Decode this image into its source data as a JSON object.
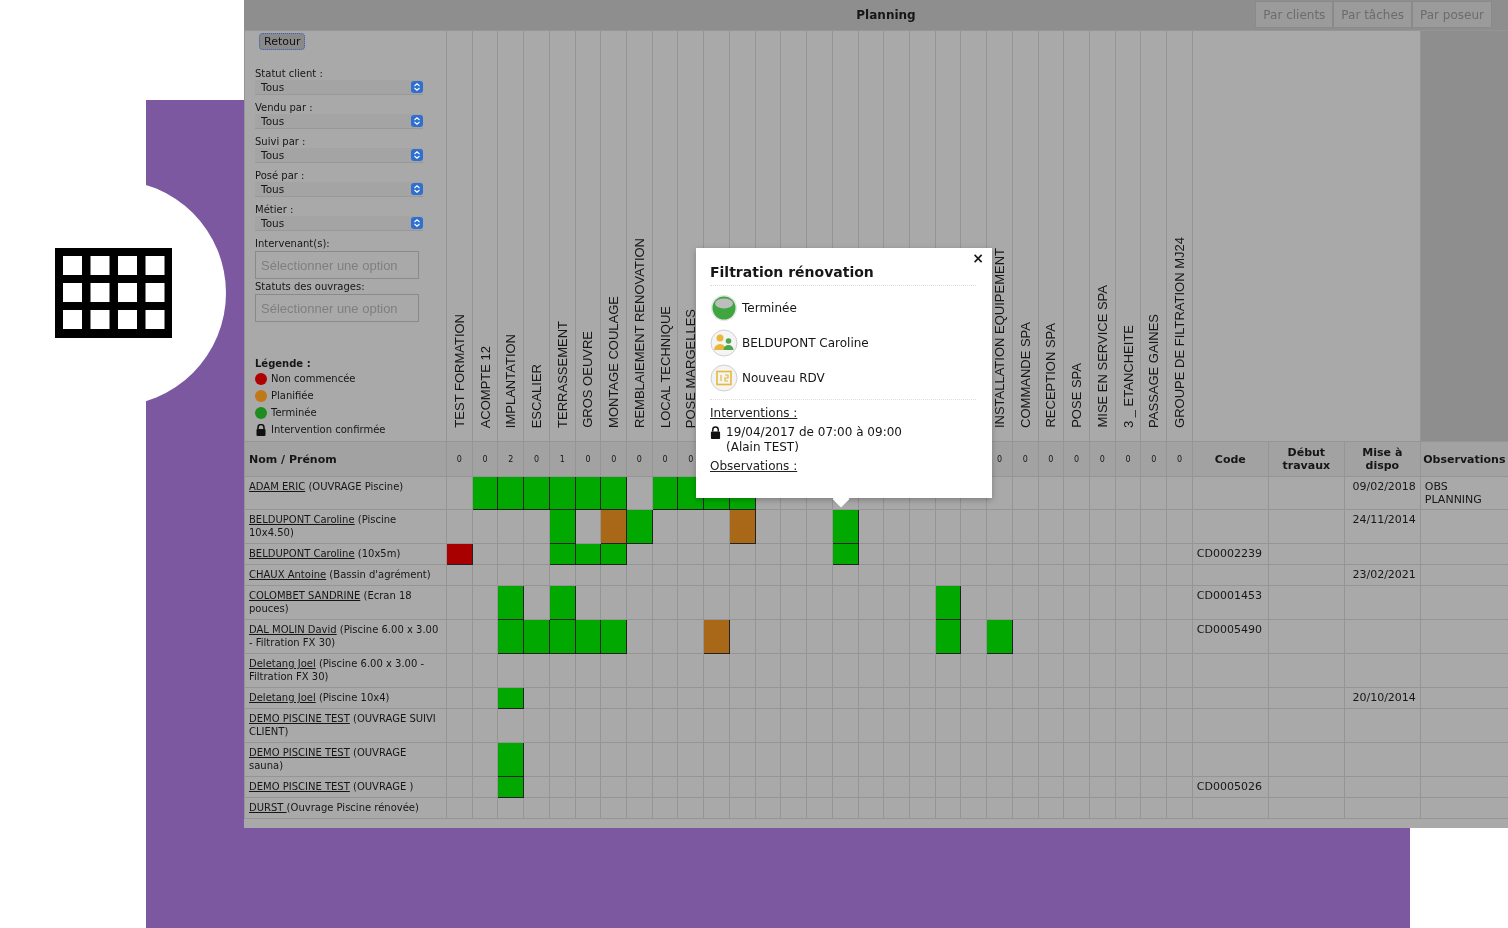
{
  "window": {
    "title": "Planning"
  },
  "view_buttons": [
    {
      "label": "Par clients"
    },
    {
      "label": "Par tâches"
    },
    {
      "label": "Par poseur"
    }
  ],
  "back_button": "Retour",
  "filters": [
    {
      "kind": "select",
      "label": "Statut client :",
      "value": "Tous"
    },
    {
      "kind": "select",
      "label": "Vendu par :",
      "value": "Tous"
    },
    {
      "kind": "select",
      "label": "Suivi par :",
      "value": "Tous"
    },
    {
      "kind": "select",
      "label": "Posé par :",
      "value": "Tous"
    },
    {
      "kind": "select",
      "label": "Métier :",
      "value": "Tous"
    },
    {
      "kind": "multiselect",
      "label": "Intervenant(s):",
      "placeholder": "Sélectionner une option"
    },
    {
      "kind": "multiselect",
      "label": "Statuts des ouvrages:",
      "placeholder": "Sélectionner une option"
    }
  ],
  "legend": {
    "title": "Légende :",
    "items": [
      {
        "kind": "dot",
        "color": "#b00000",
        "label": "Non commencée"
      },
      {
        "kind": "dot",
        "color": "#c07818",
        "label": "Planifiée"
      },
      {
        "kind": "dot",
        "color": "#1e8c1e",
        "label": "Terminée"
      },
      {
        "kind": "lock",
        "label": "Intervention confirmée"
      }
    ]
  },
  "table": {
    "name_header": "Nom / Prénom",
    "task_columns": [
      {
        "label": "TEST FORMATION",
        "count": "0"
      },
      {
        "label": "ACOMPTE  12",
        "count": "0"
      },
      {
        "label": "IMPLANTATION",
        "count": "2"
      },
      {
        "label": "ESCALIER",
        "count": "0"
      },
      {
        "label": "TERRASSEMENT",
        "count": "1"
      },
      {
        "label": "GROS OEUVRE",
        "count": "0"
      },
      {
        "label": "MONTAGE COULAGE",
        "count": "0"
      },
      {
        "label": "REMBLAIEMENT  RENOVATION",
        "count": "0"
      },
      {
        "label": "LOCAL TECHNIQUE",
        "count": "0"
      },
      {
        "label": "POSE MARGELLES",
        "count": "0"
      },
      {},
      {},
      {},
      {},
      {},
      {},
      {},
      {},
      {},
      {},
      {},
      {
        "label": "INSTALLATION EQUIPEMENT",
        "count": "0"
      },
      {
        "label": "COMMANDE SPA",
        "count": "0"
      },
      {
        "label": "RECEPTION SPA",
        "count": "0"
      },
      {
        "label": "POSE SPA",
        "count": "0"
      },
      {
        "label": "MISE EN SERVICE SPA",
        "count": "0"
      },
      {
        "label": "3 _ ETANCHEITE",
        "count": "0"
      },
      {
        "label": "PASSAGE GAINES",
        "count": "0"
      },
      {
        "label": "GROUPE DE FILTRATION MJ24",
        "count": "0"
      }
    ],
    "info_columns": [
      "Code",
      "Début travaux",
      "Mise à dispo",
      "Observations"
    ],
    "rows": [
      {
        "name": "ADAM ERIC",
        "description": "(OUVRAGE Piscine)",
        "available": "09/02/2018",
        "observations": "OBS PLANNING",
        "cells": [
          {
            "kind": "empty"
          },
          {
            "kind": "done"
          },
          {
            "kind": "done"
          },
          {
            "kind": "done"
          },
          {
            "kind": "done"
          },
          {
            "kind": "done"
          },
          {
            "kind": "done"
          },
          {
            "kind": "empty"
          },
          {
            "kind": "done"
          },
          {
            "kind": "done"
          },
          {
            "kind": "done"
          },
          {
            "kind": "done"
          },
          {
            "kind": "empty"
          },
          {
            "kind": "empty"
          },
          {
            "kind": "empty"
          },
          {
            "kind": "empty"
          },
          {
            "kind": "empty"
          },
          {
            "kind": "empty"
          },
          {
            "kind": "empty"
          },
          {
            "kind": "empty"
          },
          {
            "kind": "empty"
          },
          {
            "kind": "empty"
          },
          {
            "kind": "empty"
          },
          {
            "kind": "empty"
          },
          {
            "kind": "empty"
          },
          {
            "kind": "empty"
          },
          {
            "kind": "empty"
          },
          {
            "kind": "empty"
          },
          {
            "kind": "empty"
          }
        ]
      },
      {
        "name": "BELDUPONT Caroline",
        "description": "(Piscine 10x4.50)",
        "available": "24/11/2014",
        "cells": [
          {
            "kind": "empty"
          },
          {
            "kind": "empty"
          },
          {
            "kind": "empty"
          },
          {
            "kind": "empty"
          },
          {
            "kind": "done"
          },
          {
            "kind": "empty"
          },
          {
            "kind": "planned"
          },
          {
            "kind": "done"
          },
          {
            "kind": "empty"
          },
          {
            "kind": "empty"
          },
          {
            "kind": "empty"
          },
          {
            "kind": "planned"
          },
          {
            "kind": "empty"
          },
          {
            "kind": "empty"
          },
          {
            "kind": "empty"
          },
          {
            "kind": "done"
          },
          {
            "kind": "empty"
          },
          {
            "kind": "empty"
          },
          {
            "kind": "empty"
          },
          {
            "kind": "empty"
          },
          {
            "kind": "empty"
          },
          {
            "kind": "empty"
          },
          {
            "kind": "empty"
          },
          {
            "kind": "empty"
          },
          {
            "kind": "empty"
          },
          {
            "kind": "empty"
          },
          {
            "kind": "empty"
          },
          {
            "kind": "empty"
          },
          {
            "kind": "empty"
          }
        ]
      },
      {
        "name": "BELDUPONT Caroline",
        "description": "(10x5m)",
        "code": "CD0002239",
        "cells": [
          {
            "kind": "not_started"
          },
          {
            "kind": "empty"
          },
          {
            "kind": "empty"
          },
          {
            "kind": "empty"
          },
          {
            "kind": "done"
          },
          {
            "kind": "done"
          },
          {
            "kind": "done"
          },
          {
            "kind": "empty"
          },
          {
            "kind": "empty"
          },
          {
            "kind": "empty"
          },
          {
            "kind": "empty"
          },
          {
            "kind": "empty"
          },
          {
            "kind": "empty"
          },
          {
            "kind": "empty"
          },
          {
            "kind": "empty"
          },
          {
            "kind": "done"
          },
          {
            "kind": "empty"
          },
          {
            "kind": "empty"
          },
          {
            "kind": "empty"
          },
          {
            "kind": "empty"
          },
          {
            "kind": "empty"
          },
          {
            "kind": "empty"
          },
          {
            "kind": "empty"
          },
          {
            "kind": "empty"
          },
          {
            "kind": "empty"
          },
          {
            "kind": "empty"
          },
          {
            "kind": "empty"
          },
          {
            "kind": "empty"
          },
          {
            "kind": "empty"
          }
        ]
      },
      {
        "name": "CHAUX Antoine",
        "description": "(Bassin d'agrément)",
        "available": "23/02/2021",
        "cells": [
          {
            "kind": "empty"
          },
          {
            "kind": "empty"
          },
          {
            "kind": "empty"
          },
          {
            "kind": "empty"
          },
          {
            "kind": "empty"
          },
          {
            "kind": "empty"
          },
          {
            "kind": "empty"
          },
          {
            "kind": "empty"
          },
          {
            "kind": "empty"
          },
          {
            "kind": "empty"
          },
          {
            "kind": "empty"
          },
          {
            "kind": "empty"
          },
          {
            "kind": "empty"
          },
          {
            "kind": "empty"
          },
          {
            "kind": "empty"
          },
          {
            "kind": "empty"
          },
          {
            "kind": "empty"
          },
          {
            "kind": "empty"
          },
          {
            "kind": "empty"
          },
          {
            "kind": "empty"
          },
          {
            "kind": "empty"
          },
          {
            "kind": "empty"
          },
          {
            "kind": "empty"
          },
          {
            "kind": "empty"
          },
          {
            "kind": "empty"
          },
          {
            "kind": "empty"
          },
          {
            "kind": "empty"
          },
          {
            "kind": "empty"
          },
          {
            "kind": "empty"
          }
        ]
      },
      {
        "name": "COLOMBET SANDRINE",
        "description": "(Ecran 18 pouces)",
        "code": "CD0001453",
        "cells": [
          {
            "kind": "empty"
          },
          {
            "kind": "empty"
          },
          {
            "kind": "done"
          },
          {
            "kind": "empty"
          },
          {
            "kind": "done"
          },
          {
            "kind": "empty"
          },
          {
            "kind": "empty"
          },
          {
            "kind": "empty"
          },
          {
            "kind": "empty"
          },
          {
            "kind": "empty"
          },
          {
            "kind": "empty"
          },
          {
            "kind": "empty"
          },
          {
            "kind": "empty"
          },
          {
            "kind": "empty"
          },
          {
            "kind": "empty"
          },
          {
            "kind": "empty"
          },
          {
            "kind": "empty"
          },
          {
            "kind": "empty"
          },
          {
            "kind": "empty"
          },
          {
            "kind": "done"
          },
          {
            "kind": "empty"
          },
          {
            "kind": "empty"
          },
          {
            "kind": "empty"
          },
          {
            "kind": "empty"
          },
          {
            "kind": "empty"
          },
          {
            "kind": "empty"
          },
          {
            "kind": "empty"
          },
          {
            "kind": "empty"
          },
          {
            "kind": "empty"
          }
        ]
      },
      {
        "name": "DAL MOLIN David",
        "description": "(Piscine 6.00 x 3.00 - Filtration FX 30)",
        "code": "CD0005490",
        "cells": [
          {
            "kind": "empty"
          },
          {
            "kind": "empty"
          },
          {
            "kind": "done"
          },
          {
            "kind": "done"
          },
          {
            "kind": "done"
          },
          {
            "kind": "done"
          },
          {
            "kind": "done"
          },
          {
            "kind": "empty"
          },
          {
            "kind": "empty"
          },
          {
            "kind": "empty"
          },
          {
            "kind": "planned"
          },
          {
            "kind": "empty"
          },
          {
            "kind": "empty"
          },
          {
            "kind": "empty"
          },
          {
            "kind": "empty"
          },
          {
            "kind": "empty"
          },
          {
            "kind": "empty"
          },
          {
            "kind": "empty"
          },
          {
            "kind": "empty"
          },
          {
            "kind": "done"
          },
          {
            "kind": "empty"
          },
          {
            "kind": "done"
          },
          {
            "kind": "empty"
          },
          {
            "kind": "empty"
          },
          {
            "kind": "empty"
          },
          {
            "kind": "empty"
          },
          {
            "kind": "empty"
          },
          {
            "kind": "empty"
          },
          {
            "kind": "empty"
          }
        ]
      },
      {
        "name": "Deletang Joel",
        "description": "(Piscine 6.00 x 3.00 - Filtration FX 30)",
        "cells": [
          {
            "kind": "empty"
          },
          {
            "kind": "empty"
          },
          {
            "kind": "empty"
          },
          {
            "kind": "empty"
          },
          {
            "kind": "empty"
          },
          {
            "kind": "empty"
          },
          {
            "kind": "empty"
          },
          {
            "kind": "empty"
          },
          {
            "kind": "empty"
          },
          {
            "kind": "empty"
          },
          {
            "kind": "empty"
          },
          {
            "kind": "empty"
          },
          {
            "kind": "empty"
          },
          {
            "kind": "empty"
          },
          {
            "kind": "empty"
          },
          {
            "kind": "empty"
          },
          {
            "kind": "empty"
          },
          {
            "kind": "empty"
          },
          {
            "kind": "empty"
          },
          {
            "kind": "empty"
          },
          {
            "kind": "empty"
          },
          {
            "kind": "empty"
          },
          {
            "kind": "empty"
          },
          {
            "kind": "empty"
          },
          {
            "kind": "empty"
          },
          {
            "kind": "empty"
          },
          {
            "kind": "empty"
          },
          {
            "kind": "empty"
          },
          {
            "kind": "empty"
          }
        ]
      },
      {
        "name": "Deletang Joel",
        "description": "(Piscine 10x4)",
        "available": "20/10/2014",
        "cells": [
          {
            "kind": "empty"
          },
          {
            "kind": "empty"
          },
          {
            "kind": "done"
          },
          {
            "kind": "empty"
          },
          {
            "kind": "empty"
          },
          {
            "kind": "empty"
          },
          {
            "kind": "empty"
          },
          {
            "kind": "empty"
          },
          {
            "kind": "empty"
          },
          {
            "kind": "empty"
          },
          {
            "kind": "empty"
          },
          {
            "kind": "empty"
          },
          {
            "kind": "empty"
          },
          {
            "kind": "empty"
          },
          {
            "kind": "empty"
          },
          {
            "kind": "empty"
          },
          {
            "kind": "empty"
          },
          {
            "kind": "empty"
          },
          {
            "kind": "empty"
          },
          {
            "kind": "empty"
          },
          {
            "kind": "empty"
          },
          {
            "kind": "empty"
          },
          {
            "kind": "empty"
          },
          {
            "kind": "empty"
          },
          {
            "kind": "empty"
          },
          {
            "kind": "empty"
          },
          {
            "kind": "empty"
          },
          {
            "kind": "empty"
          },
          {
            "kind": "empty"
          }
        ]
      },
      {
        "name": "DEMO PISCINE TEST",
        "description": "(OUVRAGE SUIVI CLIENT)",
        "cells": [
          {
            "kind": "empty"
          },
          {
            "kind": "empty"
          },
          {
            "kind": "empty"
          },
          {
            "kind": "empty"
          },
          {
            "kind": "empty"
          },
          {
            "kind": "empty"
          },
          {
            "kind": "empty"
          },
          {
            "kind": "empty"
          },
          {
            "kind": "empty"
          },
          {
            "kind": "empty"
          },
          {
            "kind": "empty"
          },
          {
            "kind": "empty"
          },
          {
            "kind": "empty"
          },
          {
            "kind": "empty"
          },
          {
            "kind": "empty"
          },
          {
            "kind": "empty"
          },
          {
            "kind": "empty"
          },
          {
            "kind": "empty"
          },
          {
            "kind": "empty"
          },
          {
            "kind": "empty"
          },
          {
            "kind": "empty"
          },
          {
            "kind": "empty"
          },
          {
            "kind": "empty"
          },
          {
            "kind": "empty"
          },
          {
            "kind": "empty"
          },
          {
            "kind": "empty"
          },
          {
            "kind": "empty"
          },
          {
            "kind": "empty"
          },
          {
            "kind": "empty"
          }
        ]
      },
      {
        "name": "DEMO PISCINE TEST",
        "description": "(OUVRAGE sauna)",
        "cells": [
          {
            "kind": "empty"
          },
          {
            "kind": "empty"
          },
          {
            "kind": "done"
          },
          {
            "kind": "empty"
          },
          {
            "kind": "empty"
          },
          {
            "kind": "empty"
          },
          {
            "kind": "empty"
          },
          {
            "kind": "empty"
          },
          {
            "kind": "empty"
          },
          {
            "kind": "empty"
          },
          {
            "kind": "empty"
          },
          {
            "kind": "empty"
          },
          {
            "kind": "empty"
          },
          {
            "kind": "empty"
          },
          {
            "kind": "empty"
          },
          {
            "kind": "empty"
          },
          {
            "kind": "empty"
          },
          {
            "kind": "empty"
          },
          {
            "kind": "empty"
          },
          {
            "kind": "empty"
          },
          {
            "kind": "empty"
          },
          {
            "kind": "empty"
          },
          {
            "kind": "empty"
          },
          {
            "kind": "empty"
          },
          {
            "kind": "empty"
          },
          {
            "kind": "empty"
          },
          {
            "kind": "empty"
          },
          {
            "kind": "empty"
          },
          {
            "kind": "empty"
          }
        ]
      },
      {
        "name": "DEMO PISCINE TEST",
        "description": "(OUVRAGE )",
        "code": "CD0005026",
        "cells": [
          {
            "kind": "empty"
          },
          {
            "kind": "empty"
          },
          {
            "kind": "done"
          },
          {
            "kind": "empty"
          },
          {
            "kind": "empty"
          },
          {
            "kind": "empty"
          },
          {
            "kind": "empty"
          },
          {
            "kind": "empty"
          },
          {
            "kind": "empty"
          },
          {
            "kind": "empty"
          },
          {
            "kind": "empty"
          },
          {
            "kind": "empty"
          },
          {
            "kind": "empty"
          },
          {
            "kind": "empty"
          },
          {
            "kind": "empty"
          },
          {
            "kind": "empty"
          },
          {
            "kind": "empty"
          },
          {
            "kind": "empty"
          },
          {
            "kind": "empty"
          },
          {
            "kind": "empty"
          },
          {
            "kind": "empty"
          },
          {
            "kind": "empty"
          },
          {
            "kind": "empty"
          },
          {
            "kind": "empty"
          },
          {
            "kind": "empty"
          },
          {
            "kind": "empty"
          },
          {
            "kind": "empty"
          },
          {
            "kind": "empty"
          },
          {
            "kind": "empty"
          }
        ]
      },
      {
        "name": "DURST ",
        "description": "(Ouvrage Piscine rénovée)",
        "cells": [
          {
            "kind": "empty"
          },
          {
            "kind": "empty"
          },
          {
            "kind": "empty"
          },
          {
            "kind": "empty"
          },
          {
            "kind": "empty"
          },
          {
            "kind": "empty"
          },
          {
            "kind": "empty"
          },
          {
            "kind": "empty"
          },
          {
            "kind": "empty"
          },
          {
            "kind": "empty"
          },
          {
            "kind": "empty"
          },
          {
            "kind": "empty"
          },
          {
            "kind": "empty"
          },
          {
            "kind": "empty"
          },
          {
            "kind": "empty"
          },
          {
            "kind": "empty"
          },
          {
            "kind": "empty"
          },
          {
            "kind": "empty"
          },
          {
            "kind": "empty"
          },
          {
            "kind": "empty"
          },
          {
            "kind": "empty"
          },
          {
            "kind": "empty"
          },
          {
            "kind": "empty"
          },
          {
            "kind": "empty"
          },
          {
            "kind": "empty"
          },
          {
            "kind": "empty"
          },
          {
            "kind": "empty"
          },
          {
            "kind": "empty"
          },
          {
            "kind": "empty"
          }
        ]
      }
    ]
  },
  "popup": {
    "title": "Filtration rénovation",
    "close": "×",
    "items": [
      {
        "kind": "status",
        "label": "Terminée"
      },
      {
        "kind": "person",
        "label": "BELDUPONT Caroline"
      },
      {
        "kind": "calendar",
        "label": "Nouveau RDV"
      }
    ],
    "interventions_label": "Interventions :",
    "interventions": [
      {
        "confirmed": true,
        "date": "19/04/2017 de 07:00 à 09:00",
        "by": "(Alain TEST)"
      }
    ],
    "observations_label": "Observations :"
  }
}
